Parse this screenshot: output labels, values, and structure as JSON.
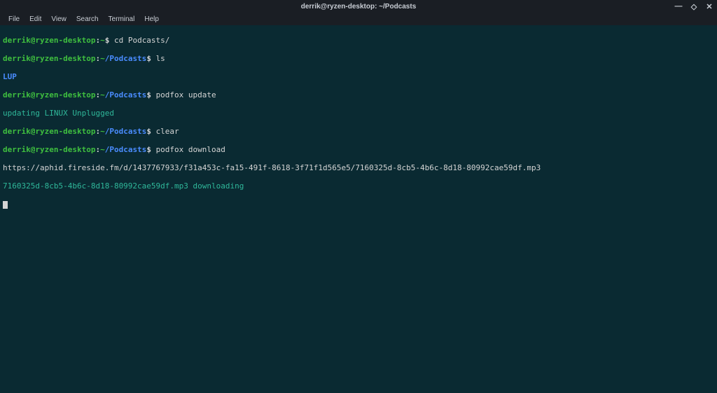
{
  "titlebar": {
    "title": "derrik@ryzen-desktop: ~/Podcasts"
  },
  "menubar": {
    "items": [
      "File",
      "Edit",
      "View",
      "Search",
      "Terminal",
      "Help"
    ]
  },
  "prompt": {
    "user_host": "derrik@ryzen-desktop",
    "home": "~",
    "dir": "/Podcasts",
    "symbol": "$"
  },
  "lines": {
    "cmd1": "cd Podcasts/",
    "cmd2": "ls",
    "out_lup": "LUP",
    "cmd3": "podfox update",
    "out_updating": "updating LINUX Unplugged",
    "cmd4": "clear",
    "cmd5": "podfox download",
    "out_url": "https://aphid.fireside.fm/d/1437767933/f31a453c-fa15-491f-8618-3f71f1d565e5/7160325d-8cb5-4b6c-8d18-80992cae59df.mp3",
    "out_downloading": "7160325d-8cb5-4b6c-8d18-80992cae59df.mp3 downloading"
  }
}
